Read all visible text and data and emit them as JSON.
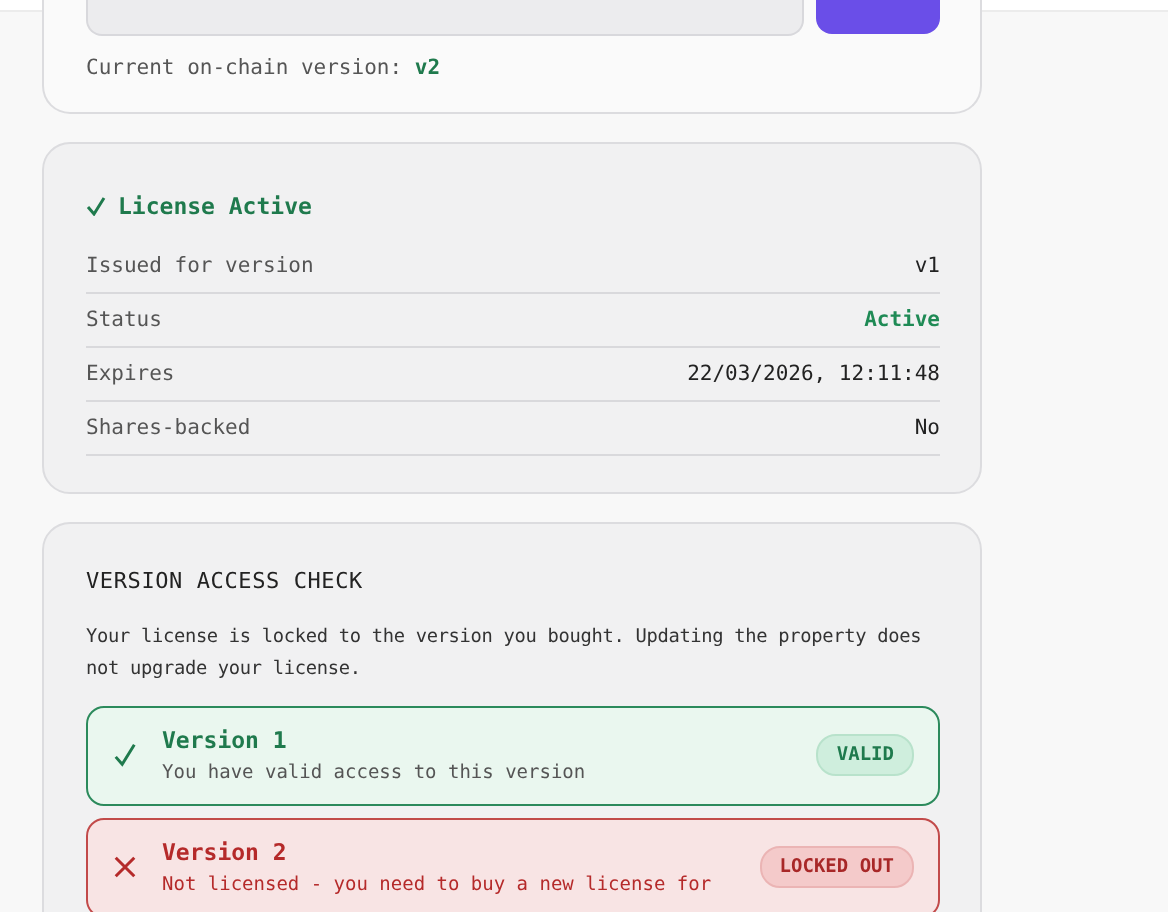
{
  "version_card": {
    "label": "Current on-chain version:",
    "version": "v2"
  },
  "license": {
    "title": "License Active",
    "active": true,
    "rows": [
      {
        "label": "Issued for version",
        "value": "v1",
        "kind": "plain"
      },
      {
        "label": "Status",
        "value": "Active",
        "kind": "success"
      },
      {
        "label": "Expires",
        "value": "22/03/2026, 12:11:48",
        "kind": "plain"
      },
      {
        "label": "Shares-backed",
        "value": "No",
        "kind": "plain"
      }
    ]
  },
  "access_check": {
    "heading": "VERSION ACCESS CHECK",
    "description": "Your license is locked to the version you bought. Updating the property does not upgrade your license.",
    "versions": [
      {
        "name": "Version 1",
        "detail": "You have valid access to this version",
        "badge": "VALID",
        "kind": "valid"
      },
      {
        "name": "Version 2",
        "detail": "Not licensed - you need to buy a new license for",
        "badge": "LOCKED OUT",
        "kind": "locked"
      }
    ]
  }
}
